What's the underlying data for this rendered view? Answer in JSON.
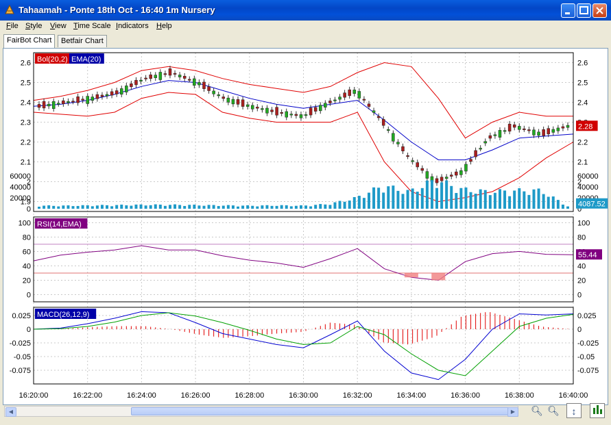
{
  "window": {
    "title": "Tahaamah - Ponte 18th Oct - 16:40 1m Nursery"
  },
  "menu": {
    "items": [
      "File",
      "Style",
      "View",
      "Time Scale",
      "Indicators",
      "Help"
    ]
  },
  "tabs": [
    "FairBot Chart",
    "Betfair Chart"
  ],
  "price_panel": {
    "bol_label": "Bol(20,2)",
    "ema_label": "EMA(20)",
    "current_price": "2.28",
    "y_ticks": [
      "2.6",
      "2.5",
      "2.4",
      "2.3",
      "2.2",
      "2.1",
      "2",
      "1.9"
    ],
    "y_values": [
      2.6,
      2.5,
      2.4,
      2.3,
      2.2,
      2.1,
      2.0,
      1.9
    ]
  },
  "volume_panel": {
    "y_ticks": [
      "60000",
      "40000",
      "20000",
      "0"
    ],
    "y_values": [
      60000,
      40000,
      20000,
      0
    ],
    "current_volume": "4087.52"
  },
  "rsi_panel": {
    "label": "RSI(14,EMA)",
    "y_ticks": [
      "100",
      "80",
      "60",
      "40",
      "20",
      "0"
    ],
    "y_values": [
      100,
      80,
      60,
      40,
      20,
      0
    ],
    "current": "55.44"
  },
  "macd_panel": {
    "label": "MACD(26,12,9)",
    "y_ticks": [
      "0.025",
      "0",
      "-0.025",
      "-0.05",
      "-0.075"
    ],
    "y_values": [
      0.025,
      0,
      -0.025,
      -0.05,
      -0.075
    ]
  },
  "x_axis": {
    "labels": [
      "16:20:00",
      "16:22:00",
      "16:24:00",
      "16:26:00",
      "16:28:00",
      "16:30:00",
      "16:32:00",
      "16:34:00",
      "16:36:00",
      "16:38:00",
      "16:40:00"
    ]
  },
  "colors": {
    "bollinger": "#e00000",
    "ema": "#0000c8",
    "rsi": "#800080",
    "volume": "#1e9ac8",
    "up": "#22aa22",
    "down": "#aa1f1f",
    "macd": "#0000d0",
    "signal": "#00a000",
    "hist": "#e00000"
  },
  "chart_data": {
    "type": "candlestick",
    "x": [
      "16:20:00",
      "16:21:00",
      "16:22:00",
      "16:23:00",
      "16:24:00",
      "16:25:00",
      "16:26:00",
      "16:27:00",
      "16:28:00",
      "16:29:00",
      "16:30:00",
      "16:31:00",
      "16:32:00",
      "16:33:00",
      "16:34:00",
      "16:35:00",
      "16:36:00",
      "16:37:00",
      "16:38:00",
      "16:39:00",
      "16:40:00"
    ],
    "price": [
      2.38,
      2.4,
      2.42,
      2.45,
      2.52,
      2.55,
      2.5,
      2.42,
      2.38,
      2.35,
      2.33,
      2.4,
      2.46,
      2.3,
      2.12,
      2.0,
      2.05,
      2.22,
      2.28,
      2.24,
      2.28
    ],
    "bol_upper": [
      2.41,
      2.43,
      2.46,
      2.5,
      2.56,
      2.58,
      2.56,
      2.52,
      2.49,
      2.47,
      2.45,
      2.48,
      2.55,
      2.6,
      2.58,
      2.42,
      2.22,
      2.3,
      2.35,
      2.33,
      2.33
    ],
    "bol_lower": [
      2.35,
      2.34,
      2.33,
      2.35,
      2.42,
      2.45,
      2.44,
      2.35,
      2.32,
      2.3,
      2.3,
      2.3,
      2.35,
      2.1,
      1.95,
      1.9,
      1.92,
      1.95,
      2.02,
      2.12,
      2.2
    ],
    "ema": [
      2.38,
      2.39,
      2.41,
      2.44,
      2.48,
      2.51,
      2.5,
      2.46,
      2.42,
      2.39,
      2.37,
      2.39,
      2.41,
      2.31,
      2.2,
      2.11,
      2.11,
      2.16,
      2.22,
      2.23,
      2.24
    ],
    "volume": [
      5000,
      5000,
      5500,
      6000,
      6500,
      6500,
      6000,
      5500,
      5000,
      5500,
      5000,
      8000,
      18000,
      38000,
      28000,
      48000,
      32000,
      28000,
      30000,
      30000,
      4087.52
    ],
    "rsi": [
      47,
      55,
      59,
      62,
      68,
      62,
      62,
      54,
      48,
      44,
      38,
      50,
      64,
      36,
      24,
      20,
      46,
      57,
      60,
      56,
      55.44
    ],
    "macd": [
      0,
      0.002,
      0.01,
      0.02,
      0.032,
      0.03,
      0.012,
      -0.008,
      -0.018,
      -0.028,
      -0.034,
      -0.01,
      0.015,
      -0.04,
      -0.08,
      -0.092,
      -0.055,
      0,
      0.028,
      0.026,
      0.028
    ],
    "signal": [
      0,
      0.001,
      0.005,
      0.013,
      0.025,
      0.03,
      0.024,
      0.012,
      -0.002,
      -0.018,
      -0.028,
      -0.025,
      0.005,
      -0.01,
      -0.045,
      -0.075,
      -0.085,
      -0.04,
      0.005,
      0.02,
      0.027
    ]
  }
}
